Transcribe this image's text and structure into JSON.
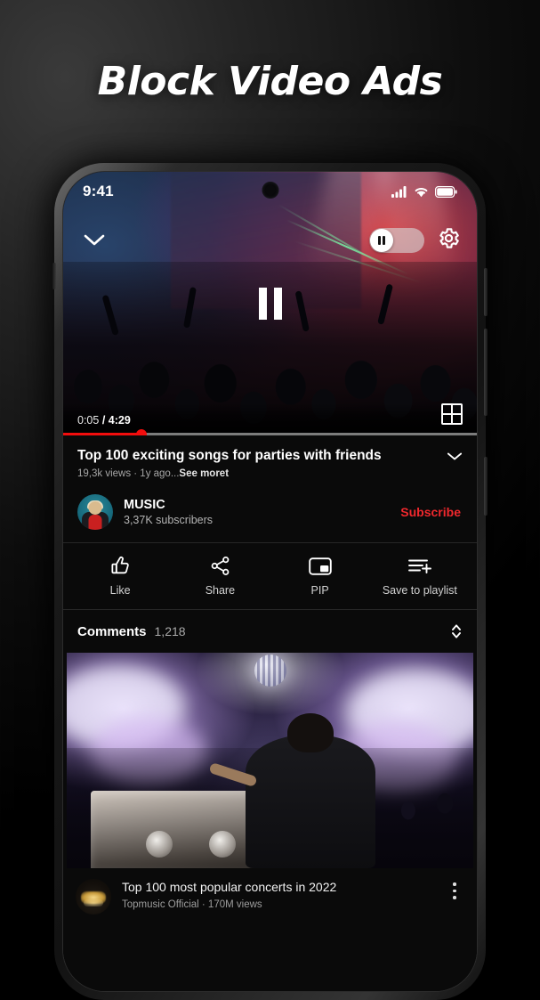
{
  "promo": {
    "headline": "Block Video Ads"
  },
  "phone": {
    "status_bar": {
      "time": "9:41",
      "icons": [
        "signal-icon",
        "wifi-icon",
        "battery-icon"
      ]
    }
  },
  "player": {
    "collapse_icon": "chevron-down-icon",
    "ad_toggle": {
      "state": "off",
      "knob_icon": "pause-icon"
    },
    "settings_icon": "gear-icon",
    "center_control_icon": "pause-icon",
    "current_time": "0:05",
    "separator": "/",
    "duration": "4:29",
    "time_display": "0:05 / 4:29",
    "progress_percent": 19,
    "fullscreen_icon": "fullscreen-icon",
    "progress_color": "#f20d0d"
  },
  "video": {
    "title": "Top 100 exciting songs for parties with friends",
    "expand_icon": "chevron-down-icon",
    "meta_plain": "19,3k views · 1y ago...",
    "meta_more": "See moret"
  },
  "channel": {
    "name": "MUSIC",
    "subscribers": "3,37K subscribers",
    "subscribe_label": "Subscribe",
    "subscribe_color": "#f0282d",
    "avatar_icon": "channel-avatar"
  },
  "actions": [
    {
      "label": "Like",
      "icon": "thumbs-up-icon"
    },
    {
      "label": "Share",
      "icon": "share-icon"
    },
    {
      "label": "PIP",
      "icon": "picture-in-picture-icon"
    },
    {
      "label": "Save to playlist",
      "icon": "playlist-add-icon"
    }
  ],
  "comments": {
    "label": "Comments",
    "count": "1,218",
    "expander_icon": "chevron-up-down-icon"
  },
  "suggestion": {
    "title": "Top 100 most popular concerts in 2022",
    "subtitle": "Topmusic Official · 170M views",
    "menu_icon": "kebab-menu-icon",
    "avatar_icon": "suggestion-avatar"
  }
}
